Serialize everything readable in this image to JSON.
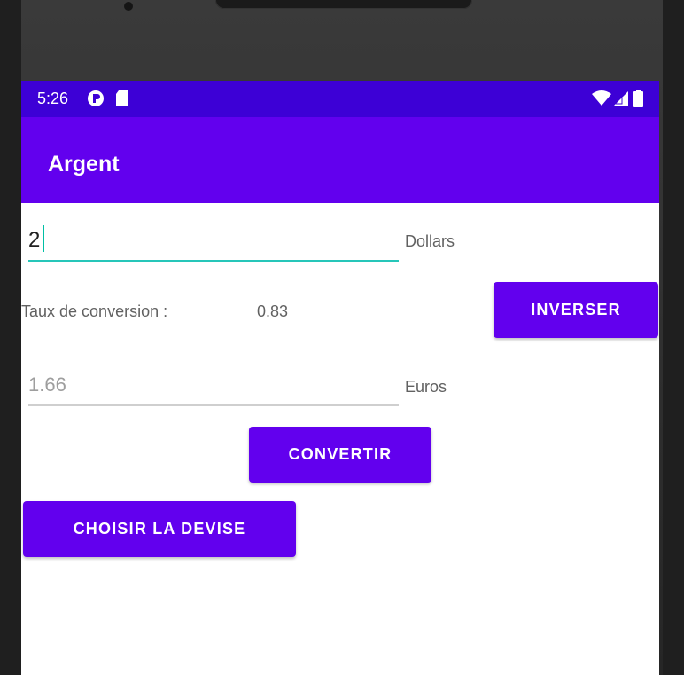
{
  "status_bar": {
    "time": "5:26",
    "icons": [
      "app-notification-icon",
      "sd-card-icon",
      "wifi-icon",
      "signal-icon",
      "battery-icon"
    ]
  },
  "app_bar": {
    "title": "Argent"
  },
  "amount_input": {
    "value": "2",
    "unit": "Dollars"
  },
  "rate": {
    "label": "Taux de conversion :",
    "value": "0.83"
  },
  "result_input": {
    "value": "1.66",
    "unit": "Euros"
  },
  "buttons": {
    "invert": "INVERSER",
    "convert": "CONVERTIR",
    "choose_currency": "CHOISIR LA DEVISE"
  },
  "colors": {
    "status_bar": "#3d00d6",
    "primary": "#6200ee",
    "accent": "#03dac5"
  }
}
